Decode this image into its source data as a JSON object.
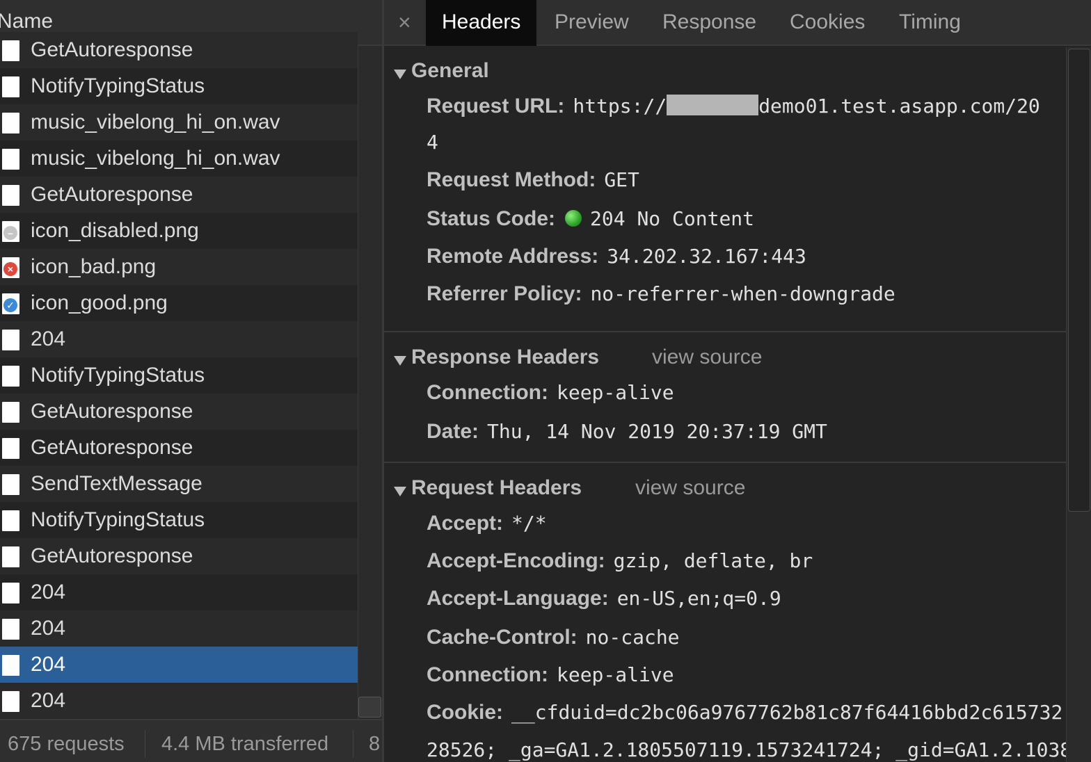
{
  "left": {
    "column_header": "Name",
    "rows": [
      {
        "label": "GetAutoresponse",
        "icon": "file-icon",
        "selected": false
      },
      {
        "label": "NotifyTypingStatus",
        "icon": "file-icon",
        "selected": false
      },
      {
        "label": "music_vibelong_hi_on.wav",
        "icon": "file-icon",
        "selected": false
      },
      {
        "label": "music_vibelong_hi_on.wav",
        "icon": "file-icon",
        "selected": false
      },
      {
        "label": "GetAutoresponse",
        "icon": "file-icon",
        "selected": false
      },
      {
        "label": "icon_disabled.png",
        "icon": "disabled-image-icon",
        "selected": false
      },
      {
        "label": "icon_bad.png",
        "icon": "bad-image-icon",
        "selected": false
      },
      {
        "label": "icon_good.png",
        "icon": "good-image-icon",
        "selected": false
      },
      {
        "label": "204",
        "icon": "file-icon",
        "selected": false
      },
      {
        "label": "NotifyTypingStatus",
        "icon": "file-icon",
        "selected": false
      },
      {
        "label": "GetAutoresponse",
        "icon": "file-icon",
        "selected": false
      },
      {
        "label": "GetAutoresponse",
        "icon": "file-icon",
        "selected": false
      },
      {
        "label": "SendTextMessage",
        "icon": "file-icon",
        "selected": false
      },
      {
        "label": "NotifyTypingStatus",
        "icon": "file-icon",
        "selected": false
      },
      {
        "label": "GetAutoresponse",
        "icon": "file-icon",
        "selected": false
      },
      {
        "label": "204",
        "icon": "file-icon",
        "selected": false
      },
      {
        "label": "204",
        "icon": "file-icon",
        "selected": false
      },
      {
        "label": "204",
        "icon": "file-icon",
        "selected": true
      },
      {
        "label": "204",
        "icon": "file-icon",
        "selected": false
      }
    ],
    "status": {
      "requests": "675 requests",
      "transferred": "4.4 MB transferred",
      "extra": "8"
    }
  },
  "right": {
    "close_symbol": "×",
    "tabs": [
      {
        "label": "Headers",
        "active": true
      },
      {
        "label": "Preview",
        "active": false
      },
      {
        "label": "Response",
        "active": false
      },
      {
        "label": "Cookies",
        "active": false
      },
      {
        "label": "Timing",
        "active": false
      }
    ],
    "general": {
      "title": "General",
      "request_url_key": "Request URL:",
      "request_url_prefix": "https://",
      "request_url_suffix": "demo01.test.asapp.com/20",
      "request_url_wrap": "4",
      "request_method_key": "Request Method:",
      "request_method": "GET",
      "status_code_key": "Status Code:",
      "status_code": "204 No Content",
      "remote_address_key": "Remote Address:",
      "remote_address": "34.202.32.167:443",
      "referrer_policy_key": "Referrer Policy:",
      "referrer_policy": "no-referrer-when-downgrade"
    },
    "response_headers": {
      "title": "Response Headers",
      "view_source": "view source",
      "connection_key": "Connection:",
      "connection": "keep-alive",
      "date_key": "Date:",
      "date": "Thu, 14 Nov 2019 20:37:19 GMT"
    },
    "request_headers": {
      "title": "Request Headers",
      "view_source": "view source",
      "accept_key": "Accept:",
      "accept": "*/*",
      "accept_encoding_key": "Accept-Encoding:",
      "accept_encoding": "gzip, deflate, br",
      "accept_language_key": "Accept-Language:",
      "accept_language": "en-US,en;q=0.9",
      "cache_control_key": "Cache-Control:",
      "cache_control": "no-cache",
      "connection_key": "Connection:",
      "connection": "keep-alive",
      "cookie_key": "Cookie:",
      "cookie_line1": "__cfduid=dc2bc06a9767762b81c87f64416bbd2c615732",
      "cookie_line2": "28526; _ga=GA1.2.1805507119.1573241724; _gid=GA1.2.1038"
    }
  },
  "colors": {
    "selected_row": "#2b5f97",
    "active_tab": "#0c0c0c",
    "status_green": "#2fa12a",
    "error_red": "#e0483e",
    "good_blue": "#3b8ad9"
  }
}
